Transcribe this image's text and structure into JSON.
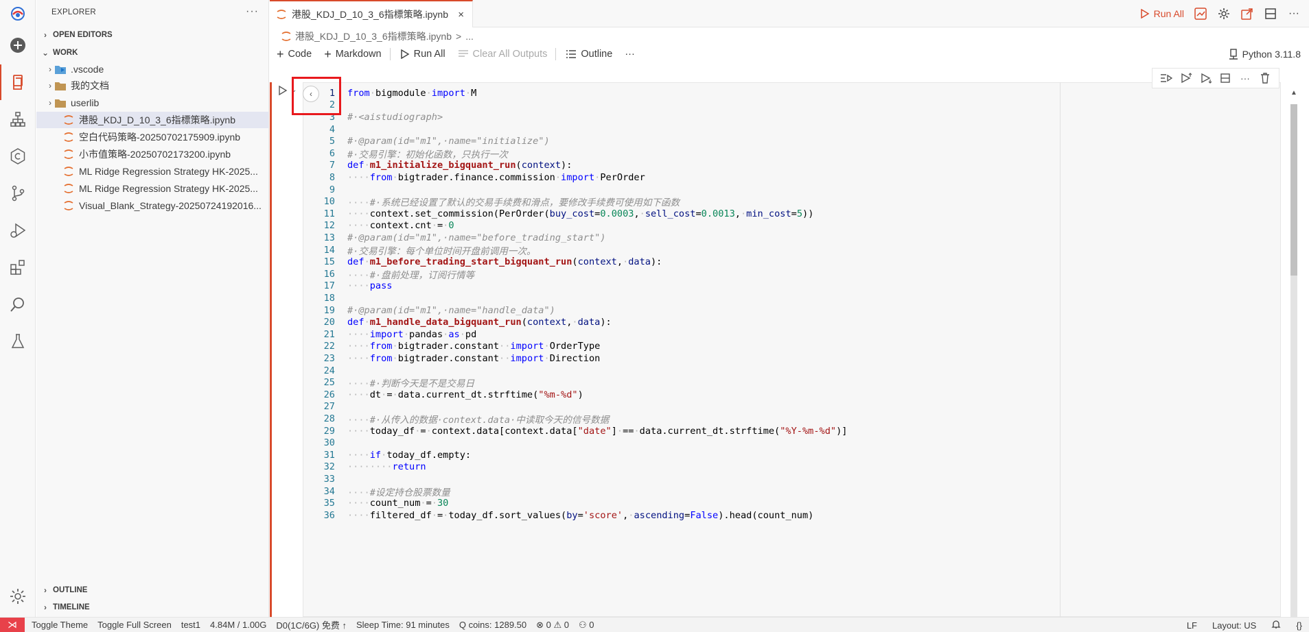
{
  "explorer": {
    "title": "EXPLORER",
    "more": "···",
    "open_editors": "OPEN EDITORS",
    "work": "WORK",
    "items": [
      {
        "label": ".vscode",
        "type": "folder-vscode",
        "indent": 1
      },
      {
        "label": "我的文档",
        "type": "folder",
        "indent": 1
      },
      {
        "label": "userlib",
        "type": "folder",
        "indent": 1
      },
      {
        "label": "港股_KDJ_D_10_3_6指標策略.ipynb",
        "type": "notebook",
        "indent": 1
      },
      {
        "label": "空白代码策略-20250702175909.ipynb",
        "type": "notebook",
        "indent": 1
      },
      {
        "label": "小市值策略-20250702173200.ipynb",
        "type": "notebook",
        "indent": 1
      },
      {
        "label": "ML Ridge Regression Strategy HK-2025...",
        "type": "notebook",
        "indent": 1
      },
      {
        "label": "ML Ridge Regression Strategy HK-2025...",
        "type": "notebook",
        "indent": 1
      },
      {
        "label": "Visual_Blank_Strategy-20250724192016...",
        "type": "notebook",
        "indent": 1
      }
    ],
    "outline": "OUTLINE",
    "timeline": "TIMELINE"
  },
  "tab": {
    "label": "港股_KDJ_D_10_3_6指標策略.ipynb",
    "close": "×"
  },
  "top_actions": {
    "run_all": "Run All"
  },
  "breadcrumb": {
    "file": "港股_KDJ_D_10_3_6指標策略.ipynb",
    "sep": ">",
    "more": "..."
  },
  "toolbar": {
    "code": "Code",
    "markdown": "Markdown",
    "run_all": "Run All",
    "clear_outputs": "Clear All Outputs",
    "outline": "Outline",
    "more": "···",
    "kernel": "Python 3.11.8"
  },
  "code_lines": [
    {
      "n": "1",
      "html": "<span class='kw'>from</span><span class='ws'>·</span>bigmodule<span class='ws'>·</span><span class='kw'>import</span><span class='ws'>·</span>M"
    },
    {
      "n": "2",
      "html": ""
    },
    {
      "n": "3",
      "html": "<span class='cm'>#·&lt;aistudiograph&gt;</span>"
    },
    {
      "n": "4",
      "html": ""
    },
    {
      "n": "5",
      "html": "<span class='cm'>#·@param(id=\"m1\",·name=\"initialize\")</span>"
    },
    {
      "n": "6",
      "html": "<span class='cm'>#·交易引擎：初始化函数，只执行一次</span>"
    },
    {
      "n": "7",
      "html": "<span class='kw'>def</span><span class='ws'>·</span><span class='dfn'>m1_initialize_bigquant_run</span>(<span class='pm'>context</span>):"
    },
    {
      "n": "8",
      "html": "<span class='ws'>····</span><span class='kw'>from</span><span class='ws'>·</span>bigtrader.finance.commission<span class='ws'>·</span><span class='kw'>import</span><span class='ws'>·</span>PerOrder"
    },
    {
      "n": "9",
      "html": ""
    },
    {
      "n": "10",
      "html": "<span class='ws'>····</span><span class='cm'>#·系统已经设置了默认的交易手续费和滑点，要修改手续费可使用如下函数</span>"
    },
    {
      "n": "11",
      "html": "<span class='ws'>····</span>context.set_commission(PerOrder(<span class='pm'>buy_cost</span>=<span class='nm'>0.0003</span>,<span class='ws'>·</span><span class='pm'>sell_cost</span>=<span class='nm'>0.0013</span>,<span class='ws'>·</span><span class='pm'>min_cost</span>=<span class='nm'>5</span>))"
    },
    {
      "n": "12",
      "html": "<span class='ws'>····</span>context.cnt<span class='ws'>·</span>=<span class='ws'>·</span><span class='nm'>0</span>"
    },
    {
      "n": "13",
      "html": "<span class='cm'>#·@param(id=\"m1\",·name=\"before_trading_start\")</span>"
    },
    {
      "n": "14",
      "html": "<span class='cm'>#·交易引擎：每个单位时间开盘前调用一次。</span>"
    },
    {
      "n": "15",
      "html": "<span class='kw'>def</span><span class='ws'>·</span><span class='dfn'>m1_before_trading_start_bigquant_run</span>(<span class='pm'>context</span>,<span class='ws'>·</span><span class='pm'>data</span>):"
    },
    {
      "n": "16",
      "html": "<span class='ws'>····</span><span class='cm'>#·盘前处理，订阅行情等</span>"
    },
    {
      "n": "17",
      "html": "<span class='ws'>····</span><span class='kw'>pass</span>"
    },
    {
      "n": "18",
      "html": ""
    },
    {
      "n": "19",
      "html": "<span class='cm'>#·@param(id=\"m1\",·name=\"handle_data\")</span>"
    },
    {
      "n": "20",
      "html": "<span class='kw'>def</span><span class='ws'>·</span><span class='dfn'>m1_handle_data_bigquant_run</span>(<span class='pm'>context</span>,<span class='ws'>·</span><span class='pm'>data</span>):"
    },
    {
      "n": "21",
      "html": "<span class='ws'>····</span><span class='kw'>import</span><span class='ws'>·</span>pandas<span class='ws'>·</span><span class='kw'>as</span><span class='ws'>·</span>pd"
    },
    {
      "n": "22",
      "html": "<span class='ws'>····</span><span class='kw'>from</span><span class='ws'>·</span>bigtrader.constant<span class='ws'>··</span><span class='kw'>import</span><span class='ws'>·</span>OrderType"
    },
    {
      "n": "23",
      "html": "<span class='ws'>····</span><span class='kw'>from</span><span class='ws'>·</span>bigtrader.constant<span class='ws'>··</span><span class='kw'>import</span><span class='ws'>·</span>Direction"
    },
    {
      "n": "24",
      "html": ""
    },
    {
      "n": "25",
      "html": "<span class='ws'>····</span><span class='cm'>#·判断今天是不是交易日</span>"
    },
    {
      "n": "26",
      "html": "<span class='ws'>····</span>dt<span class='ws'>·</span>=<span class='ws'>·</span>data.current_dt.strftime(<span class='st'>\"%m-%d\"</span>)"
    },
    {
      "n": "27",
      "html": ""
    },
    {
      "n": "28",
      "html": "<span class='ws'>····</span><span class='cm'>#·从传入的数据·context.data·中读取今天的信号数据</span>"
    },
    {
      "n": "29",
      "html": "<span class='ws'>····</span>today_df<span class='ws'>·</span>=<span class='ws'>·</span>context.data[context.data[<span class='st'>\"date\"</span>]<span class='ws'>·</span>==<span class='ws'>·</span>data.current_dt.strftime(<span class='st'>\"%Y-%m-%d\"</span>)]"
    },
    {
      "n": "30",
      "html": ""
    },
    {
      "n": "31",
      "html": "<span class='ws'>····</span><span class='kw'>if</span><span class='ws'>·</span>today_df.empty:"
    },
    {
      "n": "32",
      "html": "<span class='ws'>········</span><span class='kw'>return</span>"
    },
    {
      "n": "33",
      "html": ""
    },
    {
      "n": "34",
      "html": "<span class='ws'>····</span><span class='cm'>#设定持仓股票数量</span>"
    },
    {
      "n": "35",
      "html": "<span class='ws'>····</span>count_num<span class='ws'>·</span>=<span class='ws'>·</span><span class='nm'>30</span>"
    },
    {
      "n": "36",
      "html": "<span class='ws'>····</span>filtered_df<span class='ws'>·</span>=<span class='ws'>·</span>today_df.sort_values(<span class='pm'>by</span>=<span class='st'>'score'</span>,<span class='ws'>·</span><span class='pm'>ascending</span>=<span class='kw'>False</span>).head(count_num)"
    }
  ],
  "status": {
    "remote": "⋊",
    "toggle_theme": "Toggle Theme",
    "toggle_full": "Toggle Full Screen",
    "user": "test1",
    "memory": "4.84M / 1.00G",
    "disk": "D0(1C/6G) 免费 ↑",
    "sleep": "Sleep Time: 91 minutes",
    "coins": "Q coins: 1289.50",
    "errors": "⊗ 0 ⚠ 0",
    "ports": "⚇ 0",
    "eol": "LF",
    "layout": "Layout: US",
    "braces": "{}"
  }
}
